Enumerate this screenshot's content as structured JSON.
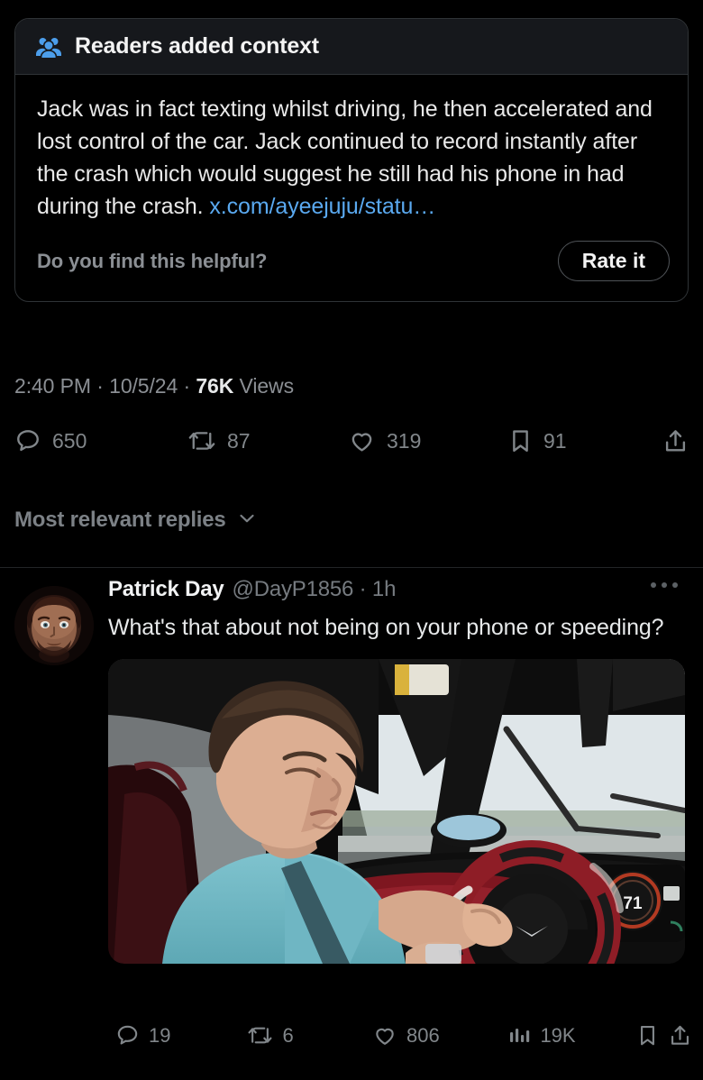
{
  "note": {
    "icon": "community-group-icon",
    "title": "Readers added context",
    "body_text": "Jack was in fact texting whilst driving, he then accelerated and lost control of the car. Jack continued to record instantly after the crash which would suggest he still had his phone in had during the crash. ",
    "body_link": "x.com/ayeejuju/statu…",
    "helpful_prompt": "Do you find this helpful?",
    "rate_label": "Rate it",
    "accent_color": "#4c9eeb",
    "link_color": "#5aa9f0"
  },
  "tweet_meta": {
    "time": "2:40 PM",
    "separator": "·",
    "date": "10/5/24",
    "views_count": "76K",
    "views_label": "Views"
  },
  "tweet_actions": {
    "reply": "650",
    "retweet": "87",
    "like": "319",
    "bookmark": "91",
    "share": ""
  },
  "replies_section": {
    "label": "Most relevant replies",
    "chevron": "chevron-down-icon"
  },
  "reply": {
    "avatar": "user-avatar-face",
    "display_name": "Patrick Day",
    "handle": "@DayP1856",
    "timestamp": "1h",
    "handle_line": "@DayP1856 · 1h",
    "text": "What's that about not being on your phone or speeding?",
    "more_icon": "more-horizontal-icon",
    "media": {
      "description": "Dashcam view inside sports car, young driver in teal shirt looking down at phone while holding red and black steering wheel",
      "speedometer_value": "71"
    },
    "actions": {
      "reply": "19",
      "retweet": "6",
      "like": "806",
      "views": "19K",
      "bookmark": "",
      "share": ""
    }
  }
}
